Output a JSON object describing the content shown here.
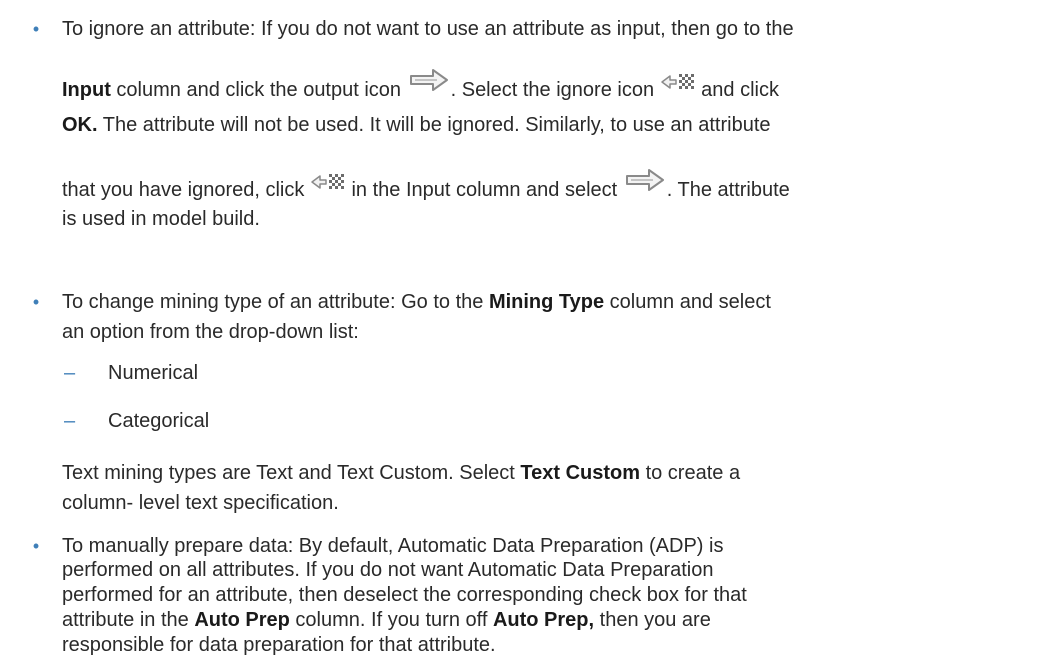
{
  "bullets": [
    {
      "lines": [
        {
          "segments": [
            {
              "t": "To ignore an attribute: If you do not want to use an attribute as input, then go to the",
              "b": false
            }
          ]
        },
        {
          "segments": [
            {
              "t": "Input",
              "b": true
            },
            {
              "t": " column and click the output icon ",
              "b": false
            },
            {
              "icon": "output-arrow-icon"
            },
            {
              "t": ". Select the ignore icon ",
              "b": false
            },
            {
              "icon": "ignore-icon"
            },
            {
              "t": " and click",
              "b": false
            }
          ]
        },
        {
          "segments": [
            {
              "t": "OK.",
              "b": true
            },
            {
              "t": " The attribute will not be used. It will be ignored. Similarly, to use an attribute",
              "b": false
            }
          ]
        },
        {
          "segments": [
            {
              "t": "that you have ignored, click ",
              "b": false
            },
            {
              "icon": "ignore-icon"
            },
            {
              "t": " in the Input column and select ",
              "b": false
            },
            {
              "icon": "output-arrow-icon"
            },
            {
              "t": ". The attribute",
              "b": false
            }
          ]
        },
        {
          "segments": [
            {
              "t": "is used in model build.",
              "b": false
            }
          ]
        }
      ]
    },
    {
      "lines": [
        {
          "segments": [
            {
              "t": "To change mining type of an attribute: Go to the ",
              "b": false
            },
            {
              "t": "Mining Type",
              "b": true
            },
            {
              "t": " column and select",
              "b": false
            }
          ]
        },
        {
          "segments": [
            {
              "t": "an option from the drop-down list:",
              "b": false
            }
          ]
        }
      ],
      "subitems": [
        "Numerical",
        "Categorical"
      ],
      "paragraph": [
        {
          "segments": [
            {
              "t": "Text mining types are Text and Text Custom. Select ",
              "b": false
            },
            {
              "t": "Text Custom",
              "b": true
            },
            {
              "t": " to create a",
              "b": false
            }
          ]
        },
        {
          "segments": [
            {
              "t": "column- level text specification.",
              "b": false
            }
          ]
        }
      ]
    },
    {
      "lines": [
        {
          "segments": [
            {
              "t": "To manually prepare data: By default, Automatic Data Preparation (ADP) is",
              "b": false
            }
          ]
        },
        {
          "segments": [
            {
              "t": "performed on all attributes. If you do not want Automatic Data Preparation",
              "b": false
            }
          ]
        },
        {
          "segments": [
            {
              "t": "performed for an attribute, then deselect the corresponding check box for that",
              "b": false
            }
          ]
        },
        {
          "segments": [
            {
              "t": "attribute in the ",
              "b": false
            },
            {
              "t": "Auto Prep",
              "b": true
            },
            {
              "t": " column. If you turn off ",
              "b": false
            },
            {
              "t": "Auto Prep,",
              "b": true
            },
            {
              "t": " then you are",
              "b": false
            }
          ]
        },
        {
          "segments": [
            {
              "t": "responsible for data preparation for that attribute.",
              "b": false
            }
          ]
        }
      ]
    }
  ],
  "bullet_char": "•",
  "dash_char": "–",
  "colors": {
    "bullet": "#3f7fb8",
    "text": "#2a2a2a"
  }
}
